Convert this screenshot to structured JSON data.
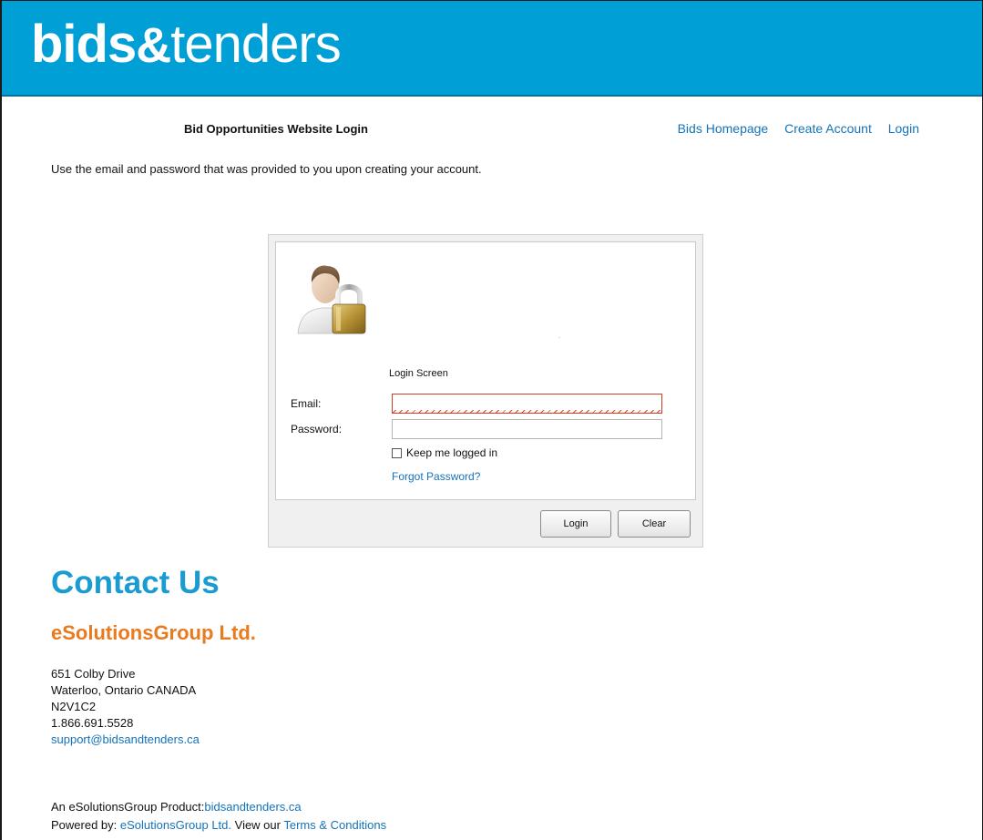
{
  "header": {
    "logo": {
      "part1": "bids",
      "amp": "&",
      "part2": "tenders"
    },
    "brand_color": "#009fd6"
  },
  "page": {
    "title": "Bid Opportunities Website Login",
    "instructions": "Use the email and password that was provided to you upon creating your account."
  },
  "nav": {
    "items": [
      {
        "label": "Bids Homepage"
      },
      {
        "label": "Create Account"
      },
      {
        "label": "Login"
      }
    ]
  },
  "login": {
    "icon": "user-lock-icon",
    "screen_label": "Login Screen",
    "email_label": "Email:",
    "email_value": "",
    "password_label": "Password:",
    "password_value": "",
    "keep_logged_in_label": "Keep me logged in",
    "keep_logged_in_checked": false,
    "forgot_password": "Forgot Password?",
    "login_button": "Login",
    "clear_button": "Clear"
  },
  "contact": {
    "heading": "Contact Us",
    "company": "eSolutionsGroup Ltd.",
    "address_line1": "651 Colby Drive",
    "address_line2": "Waterloo, Ontario CANADA",
    "postal": "N2V1C2",
    "phone": "1.866.691.5528",
    "email": "support@bidsandtenders.ca"
  },
  "footer": {
    "product_prefix": "An eSolutionsGroup Product:",
    "product_link": "bidsandtenders.ca",
    "powered_prefix": "Powered by: ",
    "powered_link": "eSolutionsGroup Ltd.",
    "view_prefix": " View our ",
    "terms_link": "Terms & Conditions"
  },
  "colors": {
    "link": "#1473b8",
    "contact_heading": "#1a9cd3",
    "company_heading": "#e97a1e",
    "error_border": "#d04020"
  }
}
